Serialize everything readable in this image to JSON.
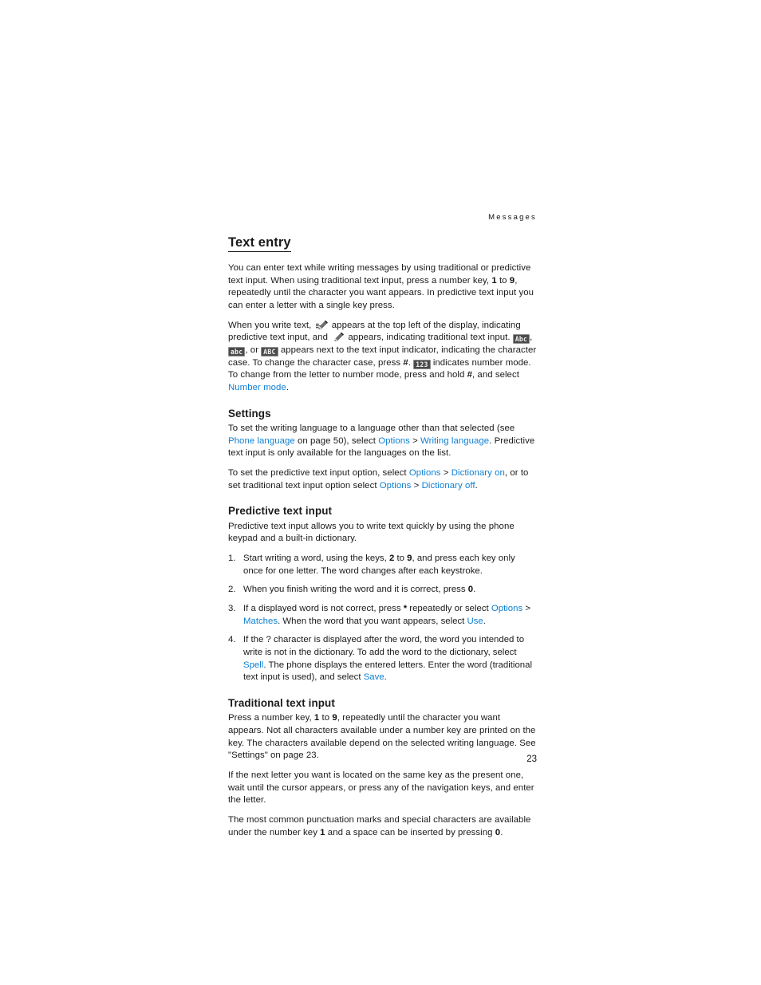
{
  "document": {
    "running_header": "Messages",
    "page_number": "23",
    "link_color": "#0d7fd3",
    "text_color": "#1a1a1a"
  },
  "chapter": {
    "title": "Text entry",
    "intro": {
      "part1": "You can enter text while writing messages by using traditional or predictive text input. When using traditional text input, press a number key, ",
      "key1": "1",
      "part2": " to ",
      "key9": "9",
      "part3": ", repeatedly until the character you want appears. In predictive text input you can enter a letter with a single key press."
    },
    "indicators": {
      "p1": "When you write text, ",
      "p2": " appears at the top left of the display, indicating predictive text input, and ",
      "p3": " appears, indicating traditional text input. ",
      "badge_abc_initial": "Abc",
      "sep1": ", ",
      "badge_abc_lower": "abc",
      "sep2": ", or ",
      "badge_abc_upper": "ABC",
      "p4": " appears next to the text input indicator, indicating the character case. To change the character case, press ",
      "key_hash_1": "#",
      "p5": ". ",
      "badge_123": "123",
      "p6": " indicates number mode. To change from the letter to number mode, press and hold ",
      "key_hash_2": "#",
      "p7": ", and select ",
      "link_number_mode": "Number mode",
      "p8": "."
    },
    "icons": {
      "predictive_icon": "predictive-text-pencil-icon",
      "traditional_icon": "traditional-text-pencil-icon"
    }
  },
  "settings": {
    "heading": "Settings",
    "para1": {
      "a": "To set the writing language to a language other than that selected (see ",
      "link_phone_language": "Phone language",
      "b": " on page 50), select ",
      "link_options": "Options",
      "c": " > ",
      "link_writing_language": "Writing language",
      "d": ". Predictive text input is only available for the languages on the list."
    },
    "para2": {
      "a": "To set the predictive text input option, select ",
      "link_options_1": "Options",
      "b": " > ",
      "link_dictionary_on": "Dictionary on",
      "c": ", or to set traditional text input option select ",
      "link_options_2": "Options",
      "d": " > ",
      "link_dictionary_off": "Dictionary off",
      "e": "."
    }
  },
  "predictive": {
    "heading": "Predictive text input",
    "intro": "Predictive text input allows you to write text quickly by using the phone keypad and a built-in dictionary.",
    "steps": [
      {
        "a": "Start writing a word, using the keys, ",
        "key_a": "2",
        "b": " to ",
        "key_b": "9",
        "c": ", and press each key only once for one letter. The word changes after each keystroke."
      },
      {
        "a": "When you finish writing the word and it is correct, press ",
        "key_a": "0",
        "b": "."
      },
      {
        "a": "If a displayed word is not correct, press ",
        "key_a": "*",
        "b": " repeatedly or select ",
        "link_options": "Options",
        "c": " > ",
        "link_matches": "Matches",
        "d": ". When the word that you want appears, select ",
        "link_use": "Use",
        "e": "."
      },
      {
        "a": "If the ? character is displayed after the word, the word you intended to write is not in the dictionary. To add the word to the dictionary, select ",
        "link_spell": "Spell",
        "b": ". The phone displays the entered letters. Enter the word (traditional text input is used), and select ",
        "link_save": "Save",
        "c": "."
      }
    ]
  },
  "traditional": {
    "heading": "Traditional text input",
    "para1": {
      "a": "Press a number key, ",
      "key_a": "1",
      "b": " to ",
      "key_b": "9",
      "c": ", repeatedly until the character you want appears. Not all characters available under a number key are printed on the key. The characters available depend on the selected writing language. See \"Settings\" on page 23."
    },
    "para2": "If the next letter you want is located on the same key as the present one, wait until the cursor appears, or press any of the navigation keys, and enter the letter.",
    "para3": {
      "a": "The most common punctuation marks and special characters are available under the number key ",
      "key_a": "1",
      "b": " and a space can be inserted by pressing ",
      "key_b": "0",
      "c": "."
    }
  }
}
